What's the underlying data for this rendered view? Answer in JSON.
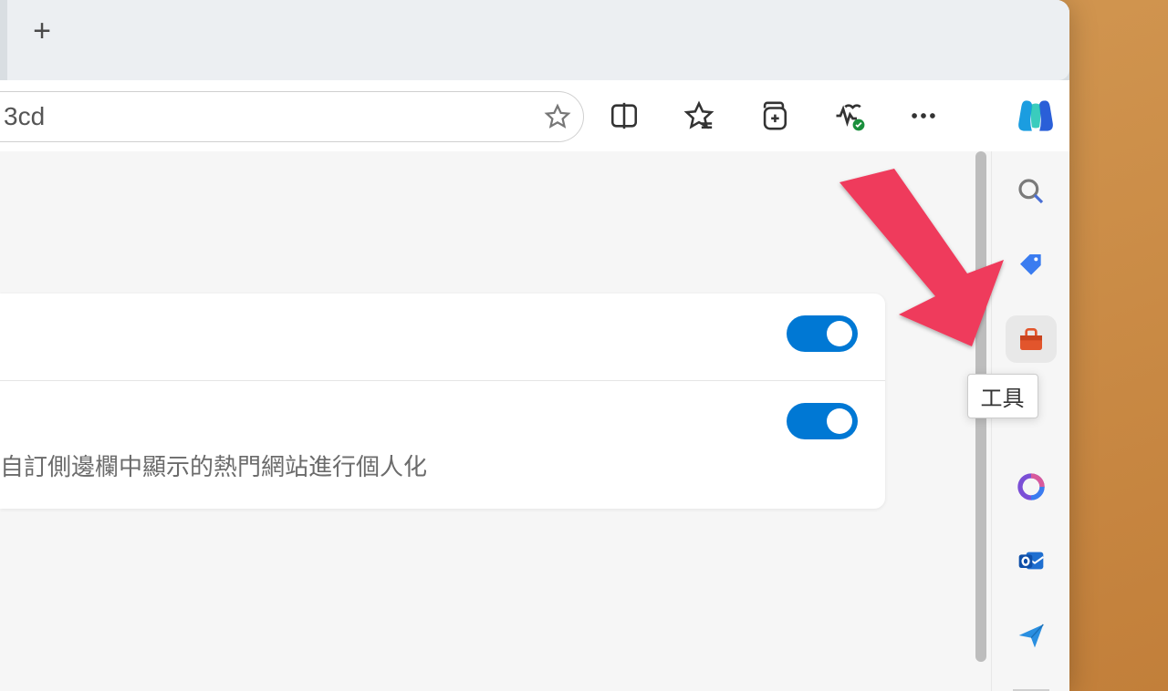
{
  "tabs": {
    "new_tab_glyph": "+"
  },
  "address": {
    "fragment": "3cd"
  },
  "toolbar": {
    "star_title": "favorite",
    "split_title": "split-screen",
    "favorites_title": "favorites",
    "collections_title": "collections",
    "performance_title": "performance",
    "more_title": "more",
    "copilot_title": "copilot"
  },
  "settings": {
    "row1": {
      "toggle_on": true
    },
    "row2": {
      "toggle_on": true,
      "desc": "自訂側邊欄中顯示的熱門網站進行個人化"
    }
  },
  "sidebar": {
    "search": "search",
    "shopping": "shopping",
    "tools": "tools",
    "tools_tooltip": "工具",
    "office": "microsoft-365",
    "outlook": "outlook",
    "send": "send"
  },
  "annotation": {
    "label": "arrow-pointing-to-tools"
  }
}
